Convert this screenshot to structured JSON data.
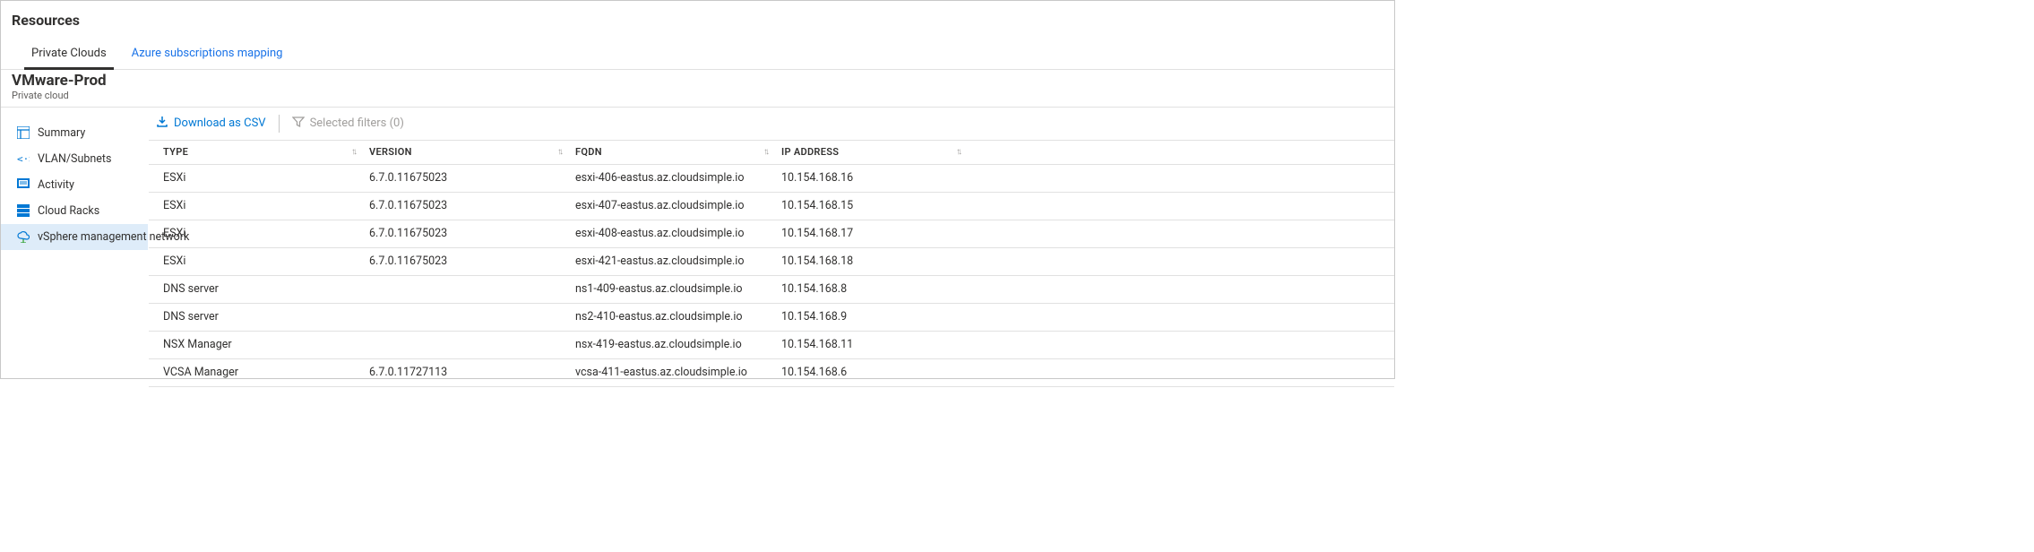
{
  "page_title": "Resources",
  "tabs": [
    {
      "label": "Private Clouds",
      "active": true
    },
    {
      "label": "Azure subscriptions mapping",
      "active": false
    }
  ],
  "cloud": {
    "name": "VMware-Prod",
    "subtitle": "Private cloud"
  },
  "sidebar": {
    "items": [
      {
        "id": "summary",
        "label": "Summary",
        "active": false
      },
      {
        "id": "vlan-subnets",
        "label": "VLAN/Subnets",
        "active": false
      },
      {
        "id": "activity",
        "label": "Activity",
        "active": false
      },
      {
        "id": "cloud-racks",
        "label": "Cloud Racks",
        "active": false
      },
      {
        "id": "vsphere-mgmt",
        "label": "vSphere management network",
        "active": true
      }
    ]
  },
  "toolbar": {
    "download_label": "Download as CSV",
    "filters_label": "Selected filters (0)"
  },
  "table": {
    "columns": [
      {
        "key": "type",
        "label": "TYPE"
      },
      {
        "key": "version",
        "label": "VERSION"
      },
      {
        "key": "fqdn",
        "label": "FQDN"
      },
      {
        "key": "ip",
        "label": "IP ADDRESS"
      }
    ],
    "rows": [
      {
        "type": "ESXi",
        "version": "6.7.0.11675023",
        "fqdn": "esxi-406-eastus.az.cloudsimple.io",
        "ip": "10.154.168.16"
      },
      {
        "type": "ESXi",
        "version": "6.7.0.11675023",
        "fqdn": "esxi-407-eastus.az.cloudsimple.io",
        "ip": "10.154.168.15"
      },
      {
        "type": "ESXi",
        "version": "6.7.0.11675023",
        "fqdn": "esxi-408-eastus.az.cloudsimple.io",
        "ip": "10.154.168.17"
      },
      {
        "type": "ESXi",
        "version": "6.7.0.11675023",
        "fqdn": "esxi-421-eastus.az.cloudsimple.io",
        "ip": "10.154.168.18"
      },
      {
        "type": "DNS server",
        "version": "",
        "fqdn": "ns1-409-eastus.az.cloudsimple.io",
        "ip": "10.154.168.8"
      },
      {
        "type": "DNS server",
        "version": "",
        "fqdn": "ns2-410-eastus.az.cloudsimple.io",
        "ip": "10.154.168.9"
      },
      {
        "type": "NSX Manager",
        "version": "",
        "fqdn": "nsx-419-eastus.az.cloudsimple.io",
        "ip": "10.154.168.11"
      },
      {
        "type": "VCSA Manager",
        "version": "6.7.0.11727113",
        "fqdn": "vcsa-411-eastus.az.cloudsimple.io",
        "ip": "10.154.168.6"
      }
    ]
  }
}
